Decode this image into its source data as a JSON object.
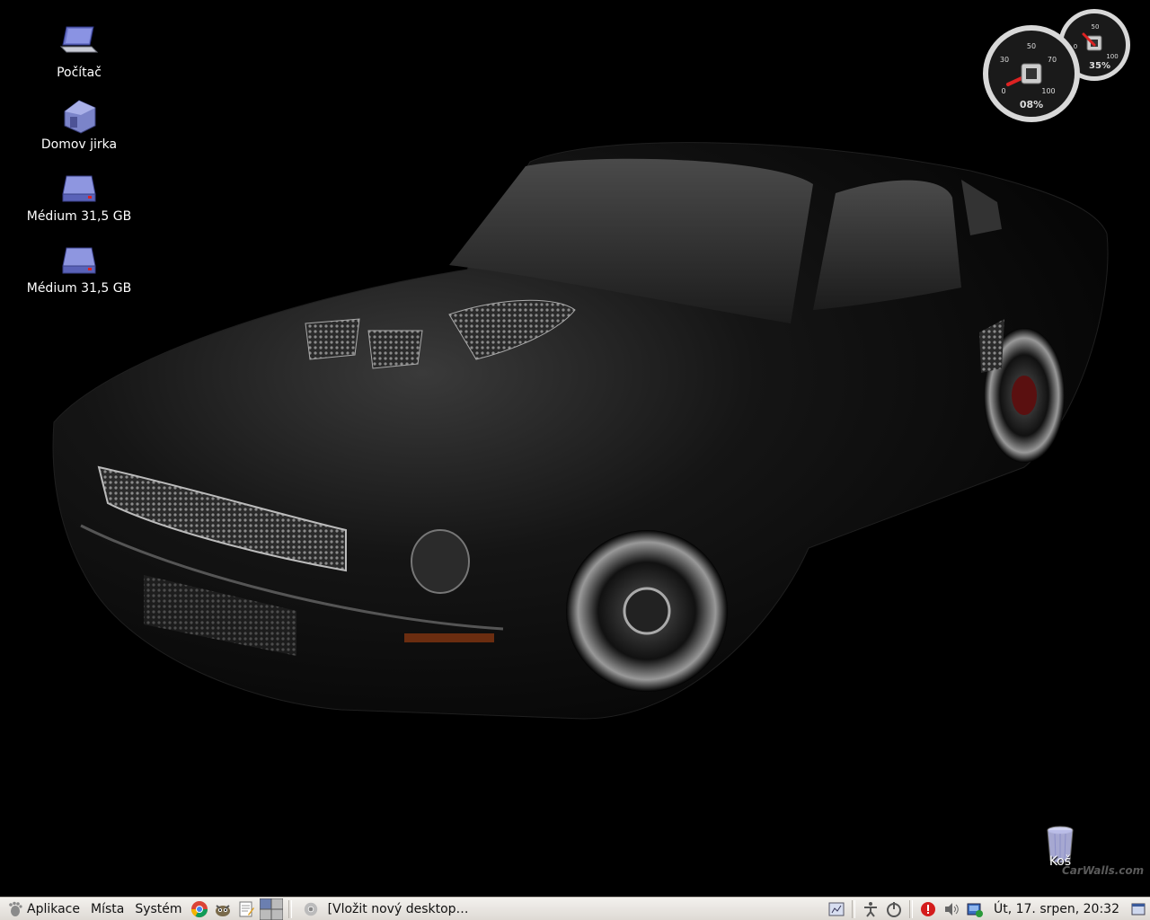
{
  "desktop": {
    "icons": [
      {
        "label": "Počítač",
        "icon": "computer-icon"
      },
      {
        "label": "Domov jirka",
        "icon": "home-folder-icon"
      },
      {
        "label": "Médium 31,5 GB",
        "icon": "drive-icon"
      },
      {
        "label": "Médium 31,5 GB",
        "icon": "drive-icon"
      }
    ],
    "trash": {
      "label": "Koš",
      "icon": "trash-icon"
    },
    "watermark": "CarWalls.com"
  },
  "gauges": {
    "cpu": {
      "value": "08%",
      "fraction": 0.08,
      "ticks": [
        "0",
        "30",
        "50",
        "70",
        "100"
      ]
    },
    "mem": {
      "value": "35%",
      "fraction": 0.35,
      "ticks": [
        "0",
        "50",
        "100"
      ]
    }
  },
  "panel": {
    "menus": {
      "apps": "Aplikace",
      "places": "Místa",
      "system": "Systém"
    },
    "launchers": [
      "chrome-icon",
      "gimp-icon",
      "text-editor-icon",
      "workspace-switcher-icon"
    ],
    "task": {
      "label": "[Vložit nový desktop…",
      "icon": "chrome-icon"
    },
    "tray_icons": [
      "network-icon",
      "accessibility-icon",
      "power-icon",
      "alert-icon",
      "volume-icon",
      "update-icon"
    ],
    "clock": "Út, 17. srpen, 20:32"
  },
  "colors": {
    "panel_bg": "#e8e5e0",
    "desktop_bg": "#000000",
    "icon_blue": "#6b74c9"
  }
}
